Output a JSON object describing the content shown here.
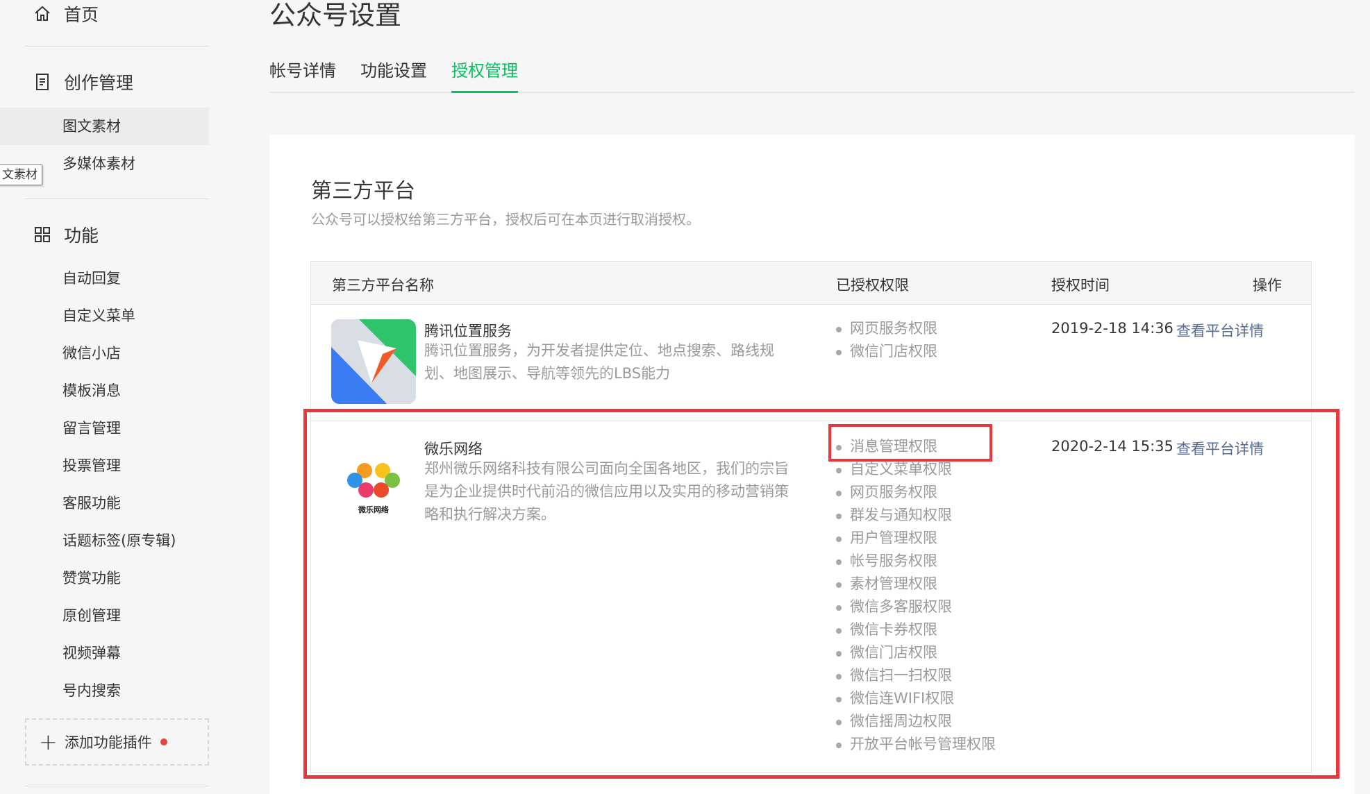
{
  "sidebar": {
    "home": "首页",
    "creation": {
      "heading": "创作管理",
      "items": [
        "图文素材",
        "多媒体素材"
      ]
    },
    "tooltip": "文素材",
    "features": {
      "heading": "功能",
      "items": [
        "自动回复",
        "自定义菜单",
        "微信小店",
        "模板消息",
        "留言管理",
        "投票管理",
        "客服功能",
        "话题标签(原专辑)",
        "赞赏功能",
        "原创管理",
        "视频弹幕",
        "号内搜索"
      ]
    },
    "add_plugin": "添加功能插件"
  },
  "page": {
    "title": "公众号设置",
    "tabs": [
      "帐号详情",
      "功能设置",
      "授权管理"
    ],
    "active_tab": "授权管理"
  },
  "section": {
    "title": "第三方平台",
    "desc": "公众号可以授权给第三方平台，授权后可在本页进行取消授权。"
  },
  "table": {
    "headers": {
      "name": "第三方平台名称",
      "perms": "已授权权限",
      "time": "授权时间",
      "action": "操作"
    },
    "rows": [
      {
        "name": "腾讯位置服务",
        "desc": "腾讯位置服务，为开发者提供定位、地点搜索、路线规划、地图展示、导航等领先的LBS能力",
        "perms": [
          "网页服务权限",
          "微信门店权限"
        ],
        "time": "2019-2-18 14:36",
        "action": "查看平台详情"
      },
      {
        "name": "微乐网络",
        "logo_text": "微乐网络",
        "desc": "郑州微乐网络科技有限公司面向全国各地区，我们的宗旨是为企业提供时代前沿的微信应用以及实用的移动营销策略和执行解决方案。",
        "perms": [
          "消息管理权限",
          "自定义菜单权限",
          "网页服务权限",
          "群发与通知权限",
          "用户管理权限",
          "帐号服务权限",
          "素材管理权限",
          "微信多客服权限",
          "微信卡券权限",
          "微信门店权限",
          "微信扫一扫权限",
          "微信连WIFI权限",
          "微信摇周边权限",
          "开放平台帐号管理权限"
        ],
        "time": "2020-2-14 15:35",
        "action": "查看平台详情"
      }
    ]
  },
  "colors": {
    "accent": "#07c160",
    "link": "#576b95",
    "highlight": "#e8353e"
  }
}
